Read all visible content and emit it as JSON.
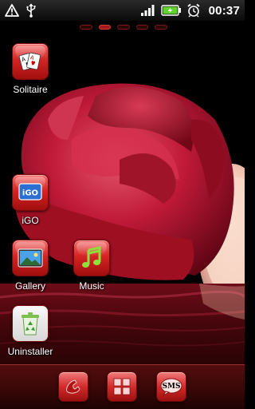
{
  "status_bar": {
    "time": "00:37",
    "left_icons": [
      "warning-icon",
      "usb-icon"
    ],
    "right_icons": [
      "signal-icon",
      "battery-charging-icon",
      "alarm-clock-icon"
    ]
  },
  "home": {
    "page_count": 5,
    "active_page": 2,
    "apps": [
      {
        "label": "Solitaire",
        "icon": "playing-cards-icon"
      },
      {
        "label": "iGO",
        "icon": "igo-navigation-icon",
        "badge": "iGO"
      },
      {
        "label": "Gallery",
        "icon": "picture-icon"
      },
      {
        "label": "Music",
        "icon": "music-note-icon"
      },
      {
        "label": "Uninstaller",
        "icon": "recycle-bin-icon"
      }
    ]
  },
  "dock": {
    "items": [
      {
        "name": "phone",
        "icon": "phone-handset-icon"
      },
      {
        "name": "app-drawer",
        "icon": "app-grid-icon"
      },
      {
        "name": "messaging",
        "icon": "sms-icon",
        "label": "SMS"
      }
    ]
  },
  "theme": {
    "accent": "#d62424",
    "accent_dark": "#9b1010",
    "background": "#000000"
  }
}
